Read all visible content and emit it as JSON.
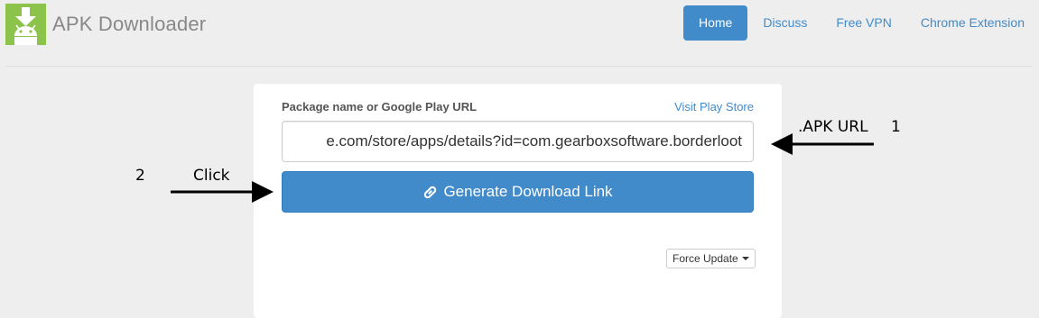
{
  "app": {
    "brand_name": "APK Downloader",
    "logo_icon": "android-download-icon"
  },
  "nav": {
    "items": [
      {
        "label": "Home",
        "active": true
      },
      {
        "label": "Discuss",
        "active": false
      },
      {
        "label": "Free VPN",
        "active": false
      },
      {
        "label": "Chrome Extension",
        "active": false
      }
    ]
  },
  "form": {
    "field_label": "Package name or Google Play URL",
    "store_link_label": "Visit Play Store",
    "url_value": "e.com/store/apps/details?id=com.gearboxsoftware.borderloot",
    "generate_button_label": "Generate Download Link",
    "generate_button_icon": "link-icon",
    "force_update_label": "Force Update"
  },
  "annotations": {
    "apk_url_label": ".APK URL",
    "step_one": "1",
    "click_label": "Click",
    "step_two": "2"
  },
  "colors": {
    "primary": "#428bca",
    "logo_green": "#8cc34a",
    "background": "#eeeeee"
  }
}
